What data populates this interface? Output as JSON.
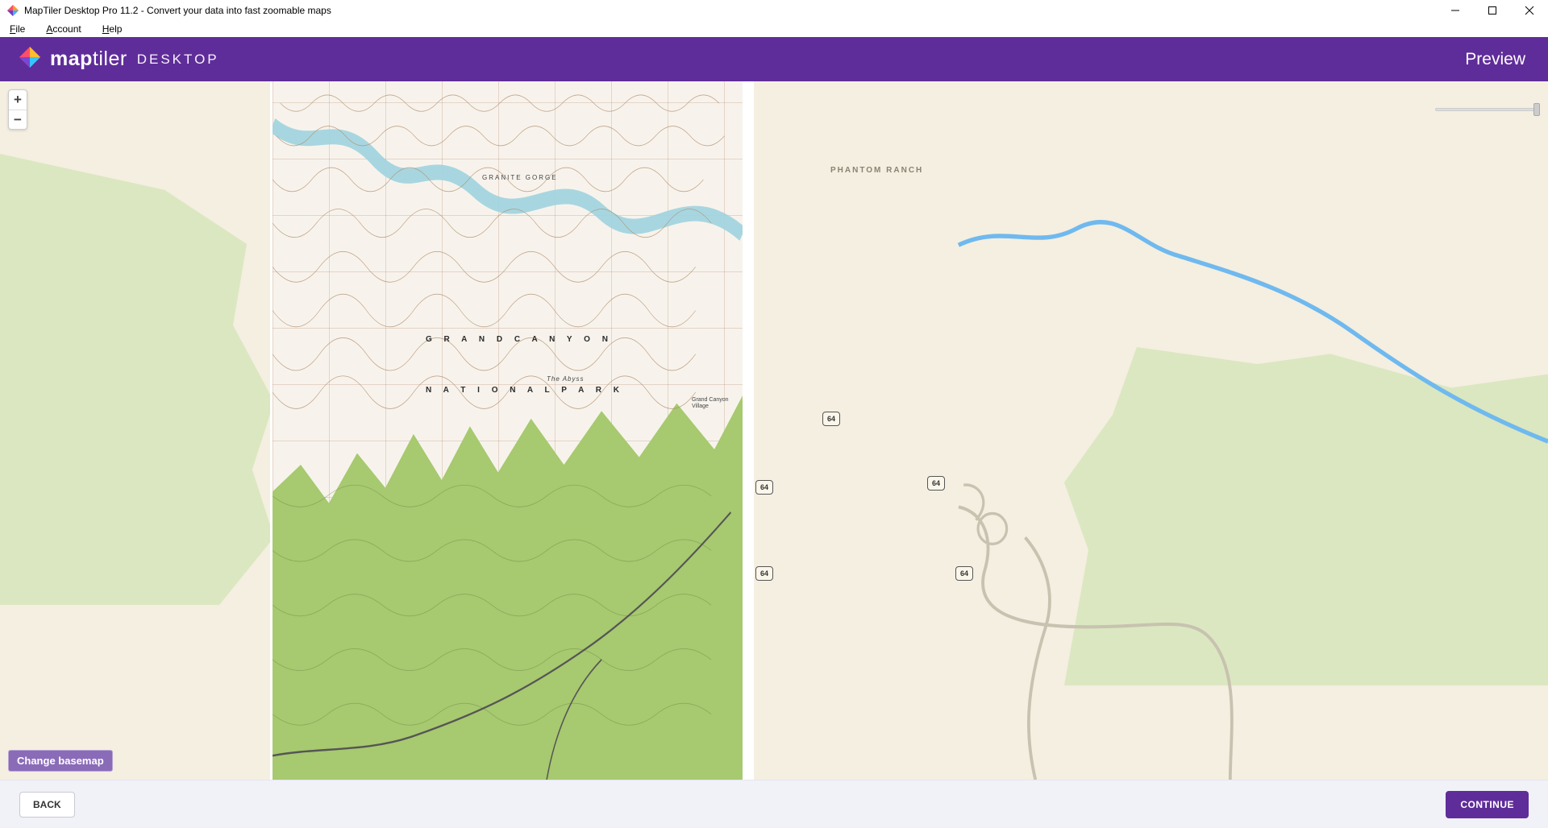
{
  "window": {
    "title": "MapTiler Desktop Pro 11.2 - Convert your data into fast zoomable maps"
  },
  "menu": {
    "file": "File",
    "account": "Account",
    "help": "Help"
  },
  "brand": {
    "name_bold": "map",
    "name_light": "tiler",
    "suffix": "DESKTOP"
  },
  "header": {
    "page_title": "Preview"
  },
  "zoom": {
    "in": "+",
    "out": "−"
  },
  "basemap": {
    "change_label": "Change basemap",
    "labels": {
      "phantom_ranch": "PHANTOM RANCH"
    },
    "routes": {
      "r64": "64"
    }
  },
  "overlay": {
    "line1": "G R A N D   C A N Y O N",
    "line2": "N A T I O N A L   P A R K",
    "gorge": "GRANITE   GORGE",
    "abyss": "The Abyss",
    "village": "Grand Canyon Village"
  },
  "footer": {
    "back": "BACK",
    "continue": "CONTINUE"
  }
}
